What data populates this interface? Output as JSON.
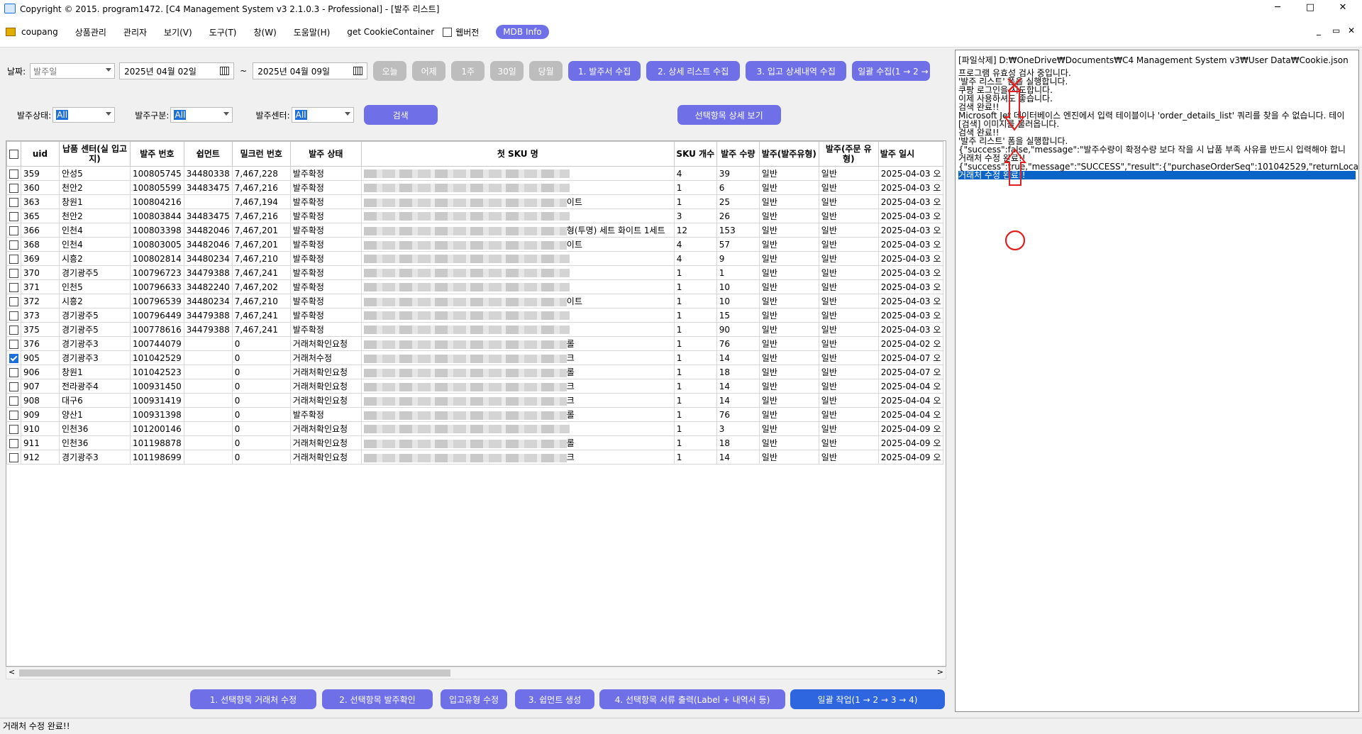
{
  "window": {
    "title": "Copyright © 2015. program1472. [C4 Management System v3 2.1.0.3 - Professional] - [발주 리스트]",
    "controls": [
      "─",
      "□",
      "✕"
    ]
  },
  "menu": {
    "items": [
      "coupang",
      "상품관리",
      "관리자",
      "보기(V)",
      "도구(T)",
      "창(W)",
      "도움말(H)",
      "get CookieContainer"
    ],
    "webview_label": "웹버전",
    "mdb_button": "MDB Info",
    "mdi_controls": [
      "_",
      "▭",
      "✕"
    ]
  },
  "filters": {
    "date_label": "날짜:",
    "date_type": "발주일",
    "date_from": "2025년 04월 02일",
    "tilde": "~",
    "date_to": "2025년 04월 09일",
    "quick_buttons": [
      "오늘",
      "어제",
      "1주",
      "30일",
      "당월"
    ],
    "action_buttons": [
      "1. 발주서 수집",
      "2. 상세 리스트 수집",
      "3. 입고 상세내역 수집",
      "일괄 수집(1 → 2 → 3)"
    ],
    "status_label": "발주상태:",
    "status_value": "All",
    "type_label": "발주구분:",
    "type_value": "All",
    "center_label": "발주센터:",
    "center_value": "All",
    "search_button": "검색",
    "detail_button": "선택항목 상세 보기"
  },
  "table": {
    "headers": [
      "uid",
      "납품 센터(실 입고지)",
      "발주 번호",
      "쉽먼트",
      "밀크런 번호",
      "발주 상태",
      "첫 SKU 명",
      "SKU 개수",
      "발주 수량",
      "발주(발주유형)",
      "발주(주문 유형)",
      "발주 일시"
    ],
    "rows": [
      {
        "checked": false,
        "uid": "359",
        "center": "안성5",
        "po": "100805745",
        "ship": "34480338",
        "milk": "7,467,228",
        "status": "발주확정",
        "sku_tail": "",
        "sku_n": "4",
        "qty": "39",
        "t1": "일반",
        "t2": "일반",
        "date": "2025-04-03 오"
      },
      {
        "checked": false,
        "uid": "360",
        "center": "천안2",
        "po": "100805599",
        "ship": "34483475",
        "milk": "7,467,216",
        "status": "발주확정",
        "sku_tail": "",
        "sku_n": "1",
        "qty": "6",
        "t1": "일반",
        "t2": "일반",
        "date": "2025-04-03 오"
      },
      {
        "checked": false,
        "uid": "363",
        "center": "창원1",
        "po": "100804216",
        "ship": "",
        "milk": "7,467,194",
        "status": "발주확정",
        "sku_tail": "이트",
        "sku_n": "1",
        "qty": "25",
        "t1": "일반",
        "t2": "일반",
        "date": "2025-04-03 오"
      },
      {
        "checked": false,
        "uid": "365",
        "center": "천안2",
        "po": "100803844",
        "ship": "34483475",
        "milk": "7,467,216",
        "status": "발주확정",
        "sku_tail": "",
        "sku_n": "3",
        "qty": "26",
        "t1": "일반",
        "t2": "일반",
        "date": "2025-04-03 오"
      },
      {
        "checked": false,
        "uid": "366",
        "center": "인천4",
        "po": "100803398",
        "ship": "34482046",
        "milk": "7,467,201",
        "status": "발주확정",
        "sku_tail": "형(투명) 세트 화이트 1세트",
        "sku_n": "12",
        "qty": "153",
        "t1": "일반",
        "t2": "일반",
        "date": "2025-04-03 오"
      },
      {
        "checked": false,
        "uid": "368",
        "center": "인천4",
        "po": "100803005",
        "ship": "34482046",
        "milk": "7,467,201",
        "status": "발주확정",
        "sku_tail": "이트",
        "sku_n": "4",
        "qty": "57",
        "t1": "일반",
        "t2": "일반",
        "date": "2025-04-03 오"
      },
      {
        "checked": false,
        "uid": "369",
        "center": "시흥2",
        "po": "100802814",
        "ship": "34480234",
        "milk": "7,467,210",
        "status": "발주확정",
        "sku_tail": "",
        "sku_n": "4",
        "qty": "9",
        "t1": "일반",
        "t2": "일반",
        "date": "2025-04-03 오"
      },
      {
        "checked": false,
        "uid": "370",
        "center": "경기광주5",
        "po": "100796723",
        "ship": "34479388",
        "milk": "7,467,241",
        "status": "발주확정",
        "sku_tail": "",
        "sku_n": "1",
        "qty": "1",
        "t1": "일반",
        "t2": "일반",
        "date": "2025-04-03 오"
      },
      {
        "checked": false,
        "uid": "371",
        "center": "인천5",
        "po": "100796633",
        "ship": "34482240",
        "milk": "7,467,202",
        "status": "발주확정",
        "sku_tail": "",
        "sku_n": "1",
        "qty": "10",
        "t1": "일반",
        "t2": "일반",
        "date": "2025-04-03 오"
      },
      {
        "checked": false,
        "uid": "372",
        "center": "시흥2",
        "po": "100796539",
        "ship": "34480234",
        "milk": "7,467,210",
        "status": "발주확정",
        "sku_tail": "이트",
        "sku_n": "1",
        "qty": "10",
        "t1": "일반",
        "t2": "일반",
        "date": "2025-04-03 오"
      },
      {
        "checked": false,
        "uid": "373",
        "center": "경기광주5",
        "po": "100796449",
        "ship": "34479388",
        "milk": "7,467,241",
        "status": "발주확정",
        "sku_tail": "",
        "sku_n": "1",
        "qty": "15",
        "t1": "일반",
        "t2": "일반",
        "date": "2025-04-03 오"
      },
      {
        "checked": false,
        "uid": "375",
        "center": "경기광주5",
        "po": "100778616",
        "ship": "34479388",
        "milk": "7,467,241",
        "status": "발주확정",
        "sku_tail": "",
        "sku_n": "1",
        "qty": "90",
        "t1": "일반",
        "t2": "일반",
        "date": "2025-04-03 오"
      },
      {
        "checked": false,
        "uid": "376",
        "center": "경기광주3",
        "po": "100744079",
        "ship": "",
        "milk": "0",
        "status": "거래처확인요청",
        "sku_tail": "롤",
        "sku_n": "1",
        "qty": "76",
        "t1": "일반",
        "t2": "일반",
        "date": "2025-04-02 오"
      },
      {
        "checked": true,
        "uid": "905",
        "center": "경기광주3",
        "po": "101042529",
        "ship": "",
        "milk": "0",
        "status": "거래처수정",
        "sku_tail": "크",
        "sku_n": "1",
        "qty": "14",
        "t1": "일반",
        "t2": "일반",
        "date": "2025-04-07 오"
      },
      {
        "checked": false,
        "uid": "906",
        "center": "창원1",
        "po": "101042523",
        "ship": "",
        "milk": "0",
        "status": "거래처확인요청",
        "sku_tail": "롤",
        "sku_n": "1",
        "qty": "18",
        "t1": "일반",
        "t2": "일반",
        "date": "2025-04-07 오"
      },
      {
        "checked": false,
        "uid": "907",
        "center": "전라광주4",
        "po": "100931450",
        "ship": "",
        "milk": "0",
        "status": "거래처확인요청",
        "sku_tail": "크",
        "sku_n": "1",
        "qty": "14",
        "t1": "일반",
        "t2": "일반",
        "date": "2025-04-04 오"
      },
      {
        "checked": false,
        "uid": "908",
        "center": "대구6",
        "po": "100931419",
        "ship": "",
        "milk": "0",
        "status": "거래처확인요청",
        "sku_tail": "크",
        "sku_n": "1",
        "qty": "14",
        "t1": "일반",
        "t2": "일반",
        "date": "2025-04-04 오"
      },
      {
        "checked": false,
        "uid": "909",
        "center": "양산1",
        "po": "100931398",
        "ship": "",
        "milk": "0",
        "status": "발주확정",
        "sku_tail": "롤",
        "sku_n": "1",
        "qty": "76",
        "t1": "일반",
        "t2": "일반",
        "date": "2025-04-04 오"
      },
      {
        "checked": false,
        "uid": "910",
        "center": "인천36",
        "po": "101200146",
        "ship": "",
        "milk": "0",
        "status": "거래처확인요청",
        "sku_tail": "",
        "sku_n": "1",
        "qty": "3",
        "t1": "일반",
        "t2": "일반",
        "date": "2025-04-09 오"
      },
      {
        "checked": false,
        "uid": "911",
        "center": "인천36",
        "po": "101198878",
        "ship": "",
        "milk": "0",
        "status": "거래처확인요청",
        "sku_tail": "롤",
        "sku_n": "1",
        "qty": "18",
        "t1": "일반",
        "t2": "일반",
        "date": "2025-04-09 오"
      },
      {
        "checked": false,
        "uid": "912",
        "center": "경기광주3",
        "po": "101198699",
        "ship": "",
        "milk": "0",
        "status": "거래처확인요청",
        "sku_tail": "크",
        "sku_n": "1",
        "qty": "14",
        "t1": "일반",
        "t2": "일반",
        "date": "2025-04-09 오"
      }
    ]
  },
  "scroll": {
    "left": "<",
    "right": ">"
  },
  "bottom_buttons": [
    "1. 선택항목 거래처 수정",
    "2. 선택항목 발주확인",
    "입고유형 수정",
    "3. 쉽먼트 생성",
    "4. 선택항목 서류 출력(Label + 내역서 등)",
    "일괄 작업(1 → 2 → 3 → 4)"
  ],
  "log": {
    "lines": [
      "[파일삭제] D:₩OneDrive₩Documents₩C4 Management System v3₩User Data₩Cookie.json",
      "",
      "프로그램 유효성 검사 중입니다.",
      "'발주 리스트' 폼을 실행합니다.",
      "쿠팡 로그인을 시도합니다.",
      "이제 사용하셔도 좋습니다.",
      "검색 완료!!",
      "Microsoft Jet 데이터베이스 엔진에서 입력 테이블이나 'order_details_list' 쿼리를 찾을 수 없습니다. 테이",
      "[검색] 이미지를 불러옵니다.",
      "검색 완료!!",
      "'발주 리스트' 폼을 실행합니다.",
      "{\"success\":false,\"message\":\"발주수량이 확정수량 보다 작을 시 납품 부족 사유를 반드시 입력해야 합니",
      "거래처 수정 완료!!",
      "{\"success\":true,\"message\":\"SUCCESS\",\"result\":{\"purchaseOrderSeq\":101042529,\"returnLocation\":\"인",
      "거래처 수정 완료!!"
    ]
  },
  "status_bar": "거래처 수정 완료!!",
  "colors": {
    "accent": "#6f6fe8",
    "inactive": "#bdbdbd",
    "selection": "#0a64c8",
    "annotation": "#e02020"
  }
}
